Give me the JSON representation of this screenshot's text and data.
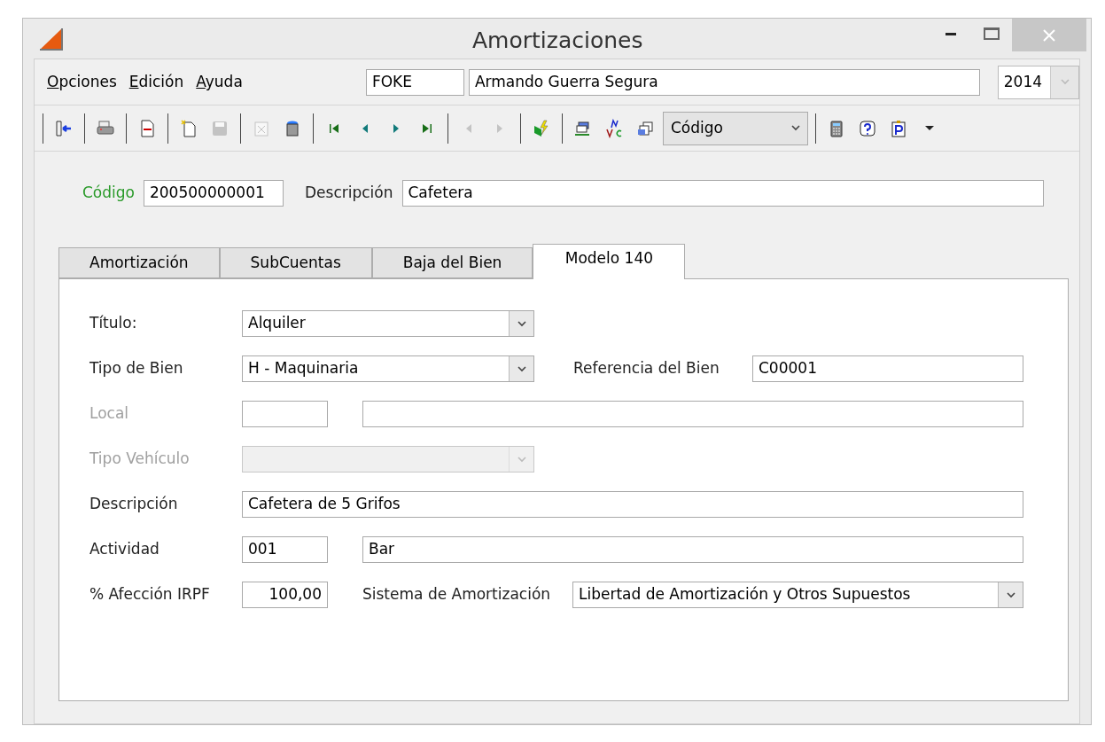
{
  "window": {
    "title": "Amortizaciones"
  },
  "menu": [
    {
      "label": "Opciones"
    },
    {
      "label": "Edición"
    },
    {
      "label": "Ayuda"
    }
  ],
  "company": {
    "code": "FOKE",
    "name": "Armando Guerra Segura",
    "year": "2014"
  },
  "toolbar": [
    {
      "kind": "separator"
    },
    {
      "kind": "button",
      "disabled": false
    },
    {
      "kind": "separator"
    },
    {
      "kind": "button",
      "disabled": false
    },
    {
      "kind": "separator"
    },
    {
      "kind": "button",
      "disabled": false
    },
    {
      "kind": "separator"
    },
    {
      "kind": "button",
      "disabled": false
    },
    {
      "kind": "button",
      "disabled": true
    },
    {
      "kind": "separator"
    },
    {
      "kind": "button",
      "disabled": true
    },
    {
      "kind": "button",
      "disabled": false
    },
    {
      "kind": "separator"
    },
    {
      "kind": "button",
      "disabled": false
    },
    {
      "kind": "button",
      "disabled": false
    },
    {
      "kind": "button",
      "disabled": false
    },
    {
      "kind": "button",
      "disabled": false
    },
    {
      "kind": "separator"
    },
    {
      "kind": "button",
      "disabled": true
    },
    {
      "kind": "button",
      "disabled": true
    },
    {
      "kind": "separator"
    },
    {
      "kind": "button",
      "disabled": false
    },
    {
      "kind": "separator"
    },
    {
      "kind": "button",
      "disabled": false
    },
    {
      "kind": "button",
      "disabled": false
    },
    {
      "kind": "button",
      "disabled": false
    },
    {
      "kind": "combo",
      "value": "Código"
    },
    {
      "kind": "separator"
    },
    {
      "kind": "button",
      "disabled": false
    },
    {
      "kind": "button",
      "disabled": false
    },
    {
      "kind": "button",
      "disabled": false
    },
    {
      "kind": "button",
      "disabled": false
    }
  ],
  "record": {
    "code_label": "Código",
    "code": "200500000001",
    "description_label": "Descripción",
    "description": "Cafetera"
  },
  "tabs": [
    {
      "label": "Amortización",
      "selected": false
    },
    {
      "label": "SubCuentas",
      "selected": false
    },
    {
      "label": "Baja del Bien",
      "selected": false
    },
    {
      "label": "Modelo 140",
      "selected": true
    }
  ],
  "form": {
    "titulo": {
      "label": "Título:",
      "value": "Alquiler",
      "disabled": false
    },
    "tipo_bien": {
      "label": "Tipo de Bien",
      "value": "H - Maquinaria",
      "disabled": false
    },
    "referencia": {
      "label": "Referencia del Bien",
      "value": "C00001"
    },
    "local": {
      "label": "Local",
      "disabled": true
    },
    "tipo_vehiculo": {
      "label": "Tipo Vehículo",
      "disabled": true
    },
    "descripcion": {
      "label": "Descripción",
      "value": "Cafetera de 5 Grifos"
    },
    "actividad": {
      "label": "Actividad",
      "code": "001",
      "name": "Bar"
    },
    "afeccion": {
      "label": "% Afección IRPF",
      "value": "100,00"
    },
    "sistema": {
      "label": "Sistema de Amortización",
      "value": "Libertad de Amortización y Otros Supuestos",
      "disabled": false
    }
  }
}
